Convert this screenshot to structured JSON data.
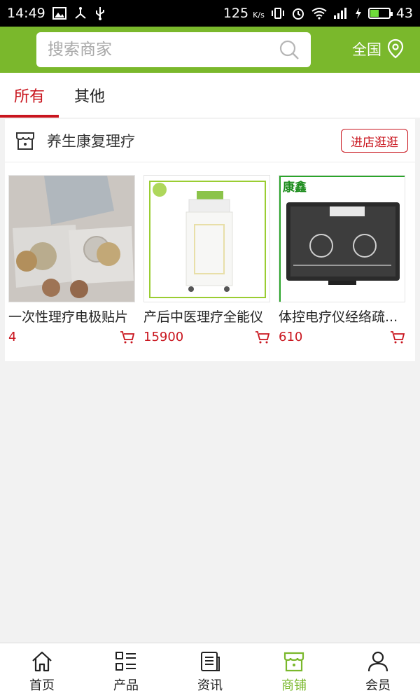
{
  "status_bar": {
    "time": "14:49",
    "network_speed": "125",
    "network_unit": "K/s",
    "battery_level": 43,
    "battery_text": "43"
  },
  "header": {
    "search_placeholder": "搜索商家",
    "region_label": "全国"
  },
  "tabs": [
    {
      "label": "所有",
      "active": true
    },
    {
      "label": "其他",
      "active": false
    }
  ],
  "shop": {
    "name": "养生康复理疗",
    "visit_label": "进店逛逛",
    "products": [
      {
        "name": "一次性理疗电极贴片",
        "price": "4"
      },
      {
        "name": "产后中医理疗全能仪",
        "price": "15900"
      },
      {
        "name": "体控电疗仪经络疏...",
        "price": "610",
        "brand_text": "康鑫"
      }
    ]
  },
  "bottom_nav": [
    {
      "label": "首页",
      "icon": "home-icon",
      "active": false
    },
    {
      "label": "产品",
      "icon": "list-icon",
      "active": false
    },
    {
      "label": "资讯",
      "icon": "news-icon",
      "active": false
    },
    {
      "label": "商铺",
      "icon": "shop-icon",
      "active": true
    },
    {
      "label": "会员",
      "icon": "user-icon",
      "active": false
    }
  ],
  "colors": {
    "brand_green": "#7ab82c",
    "accent_red": "#c9151e"
  }
}
